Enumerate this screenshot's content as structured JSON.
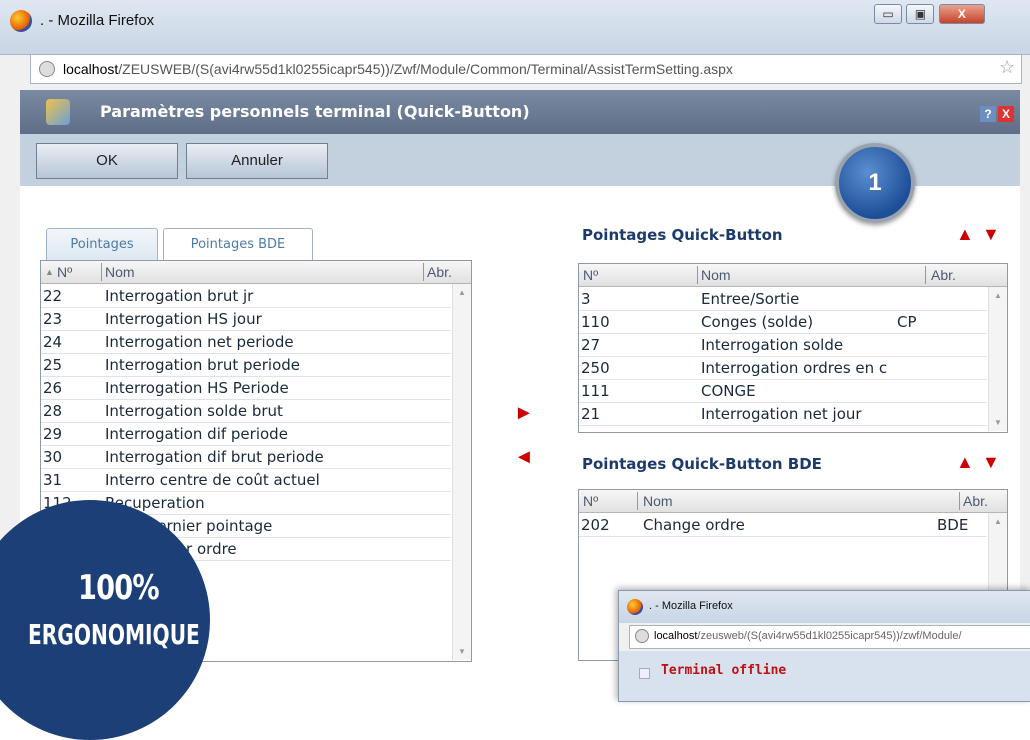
{
  "browser": {
    "window_title": ". - Mozilla Firefox",
    "url_host": "localhost",
    "url_path": "/ZEUSWEB/(S(avi4rw55d1kl0255icapr545))/Zwf/Module/Common/Terminal/AssistTermSetting.aspx",
    "minimize_symbol": "▭",
    "maximize_symbol": "▣",
    "close_symbol": "X",
    "star_symbol": "☆"
  },
  "dialog": {
    "title": "Paramètres personnels terminal (Quick-Button)",
    "help_label": "?",
    "close_label": "X",
    "ok_label": "OK",
    "cancel_label": "Annuler"
  },
  "badge": {
    "number": "1"
  },
  "tabs": [
    {
      "label": "Pointages",
      "active": false
    },
    {
      "label": "Pointages BDE",
      "active": true
    }
  ],
  "left_grid": {
    "headers": {
      "sort_icon": "▲",
      "no": "Nº",
      "nom": "Nom",
      "abr": "Abr."
    },
    "rows": [
      {
        "no": "22",
        "nom": "Interrogation brut jr",
        "abr": ""
      },
      {
        "no": "23",
        "nom": "Interrogation HS jour",
        "abr": ""
      },
      {
        "no": "24",
        "nom": "Interrogation net periode",
        "abr": ""
      },
      {
        "no": "25",
        "nom": "Interrogation brut periode",
        "abr": ""
      },
      {
        "no": "26",
        "nom": "Interrogation HS Periode",
        "abr": ""
      },
      {
        "no": "28",
        "nom": "Interrogation solde brut",
        "abr": ""
      },
      {
        "no": "29",
        "nom": "Interrogation dif periode",
        "abr": ""
      },
      {
        "no": "30",
        "nom": "Interrogation dif brut periode",
        "abr": ""
      },
      {
        "no": "31",
        "nom": "Interro centre de coût actuel",
        "abr": ""
      },
      {
        "no": "112",
        "nom": "Recuperation",
        "abr": ""
      },
      {
        "no": "1",
        "nom": "ation dernier pointage",
        "abr": ""
      },
      {
        "no": "",
        "nom": "tion dernier ordre",
        "abr": ""
      }
    ]
  },
  "move_arrows": {
    "right": "►",
    "left": "◄"
  },
  "quick_section": {
    "title": "Pointages Quick-Button",
    "up": "▲",
    "down": "▼",
    "headers": {
      "no": "Nº",
      "nom": "Nom",
      "abr": "Abr."
    },
    "rows": [
      {
        "no": "3",
        "nom": "Entree/Sortie",
        "abr": ""
      },
      {
        "no": "110",
        "nom": "Conges (solde)",
        "abr": "CP"
      },
      {
        "no": "27",
        "nom": "Interrogation solde",
        "abr": ""
      },
      {
        "no": "250",
        "nom": "Interrogation ordres en c",
        "abr": ""
      },
      {
        "no": "111",
        "nom": "CONGE",
        "abr": ""
      },
      {
        "no": "21",
        "nom": "Interrogation net jour",
        "abr": ""
      }
    ]
  },
  "bde_section": {
    "title": "Pointages Quick-Button BDE",
    "up": "▲",
    "down": "▼",
    "headers": {
      "no": "Nº",
      "nom": "Nom",
      "abr": "Abr."
    },
    "rows": [
      {
        "no": "202",
        "nom": "Change ordre",
        "abr": "BDE"
      }
    ]
  },
  "ergonomique": {
    "percent": "100%",
    "word": "ERGONOMIQUE"
  },
  "overlay": {
    "window_title": ". - Mozilla Firefox",
    "url_host": "localhost",
    "url_path": "/zeusweb/(S(avi4rw55d1kl0255icapr545))/zwf/Module/",
    "status_text": "Terminal offline"
  },
  "colors": {
    "accent_red": "#cc0000",
    "dialog_title_bg": "#6b7a92",
    "badge_blue": "#1d4f98",
    "ergo_blue": "#1c3f78"
  }
}
